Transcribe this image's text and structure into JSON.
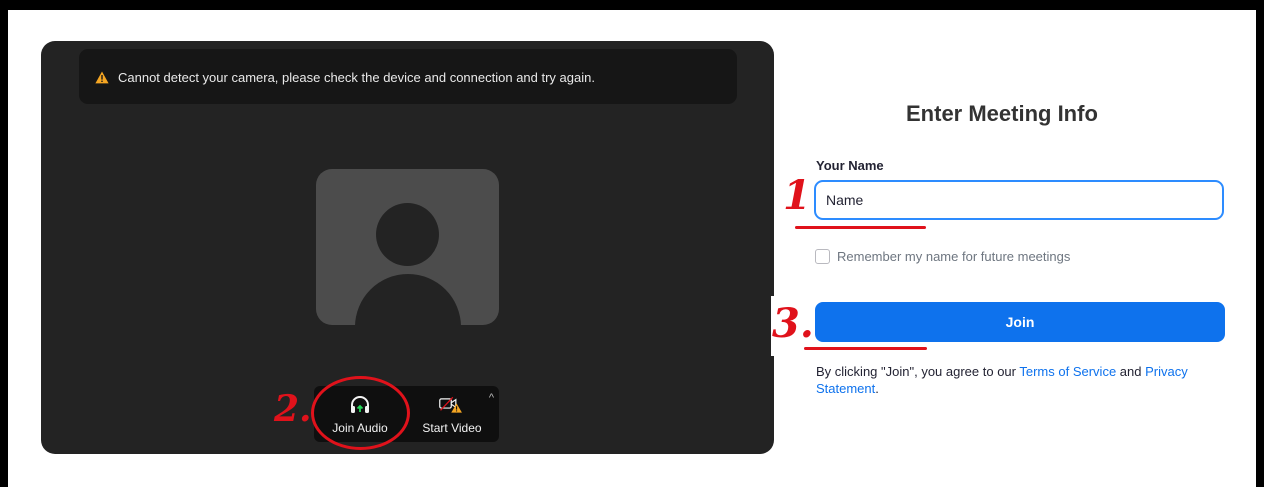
{
  "preview": {
    "warning_text": "Cannot detect your camera, please check the device and connection and try again.",
    "controls": {
      "join_audio_label": "Join Audio",
      "start_video_label": "Start Video"
    }
  },
  "annotations": {
    "one": "1.",
    "two": "2.",
    "three": "3."
  },
  "form": {
    "title": "Enter Meeting Info",
    "name_label": "Your Name",
    "name_value": "Name",
    "remember_label": "Remember my name for future meetings",
    "remember_checked": false,
    "join_label": "Join",
    "terms_prefix": "By clicking \"Join\", you agree to our ",
    "terms_link": "Terms of Service",
    "terms_and": " and ",
    "privacy_link": "Privacy Statement",
    "terms_suffix": "."
  },
  "colors": {
    "accent": "#0e72ed",
    "warning": "#f5a623",
    "annotation_red": "#e0121b"
  }
}
